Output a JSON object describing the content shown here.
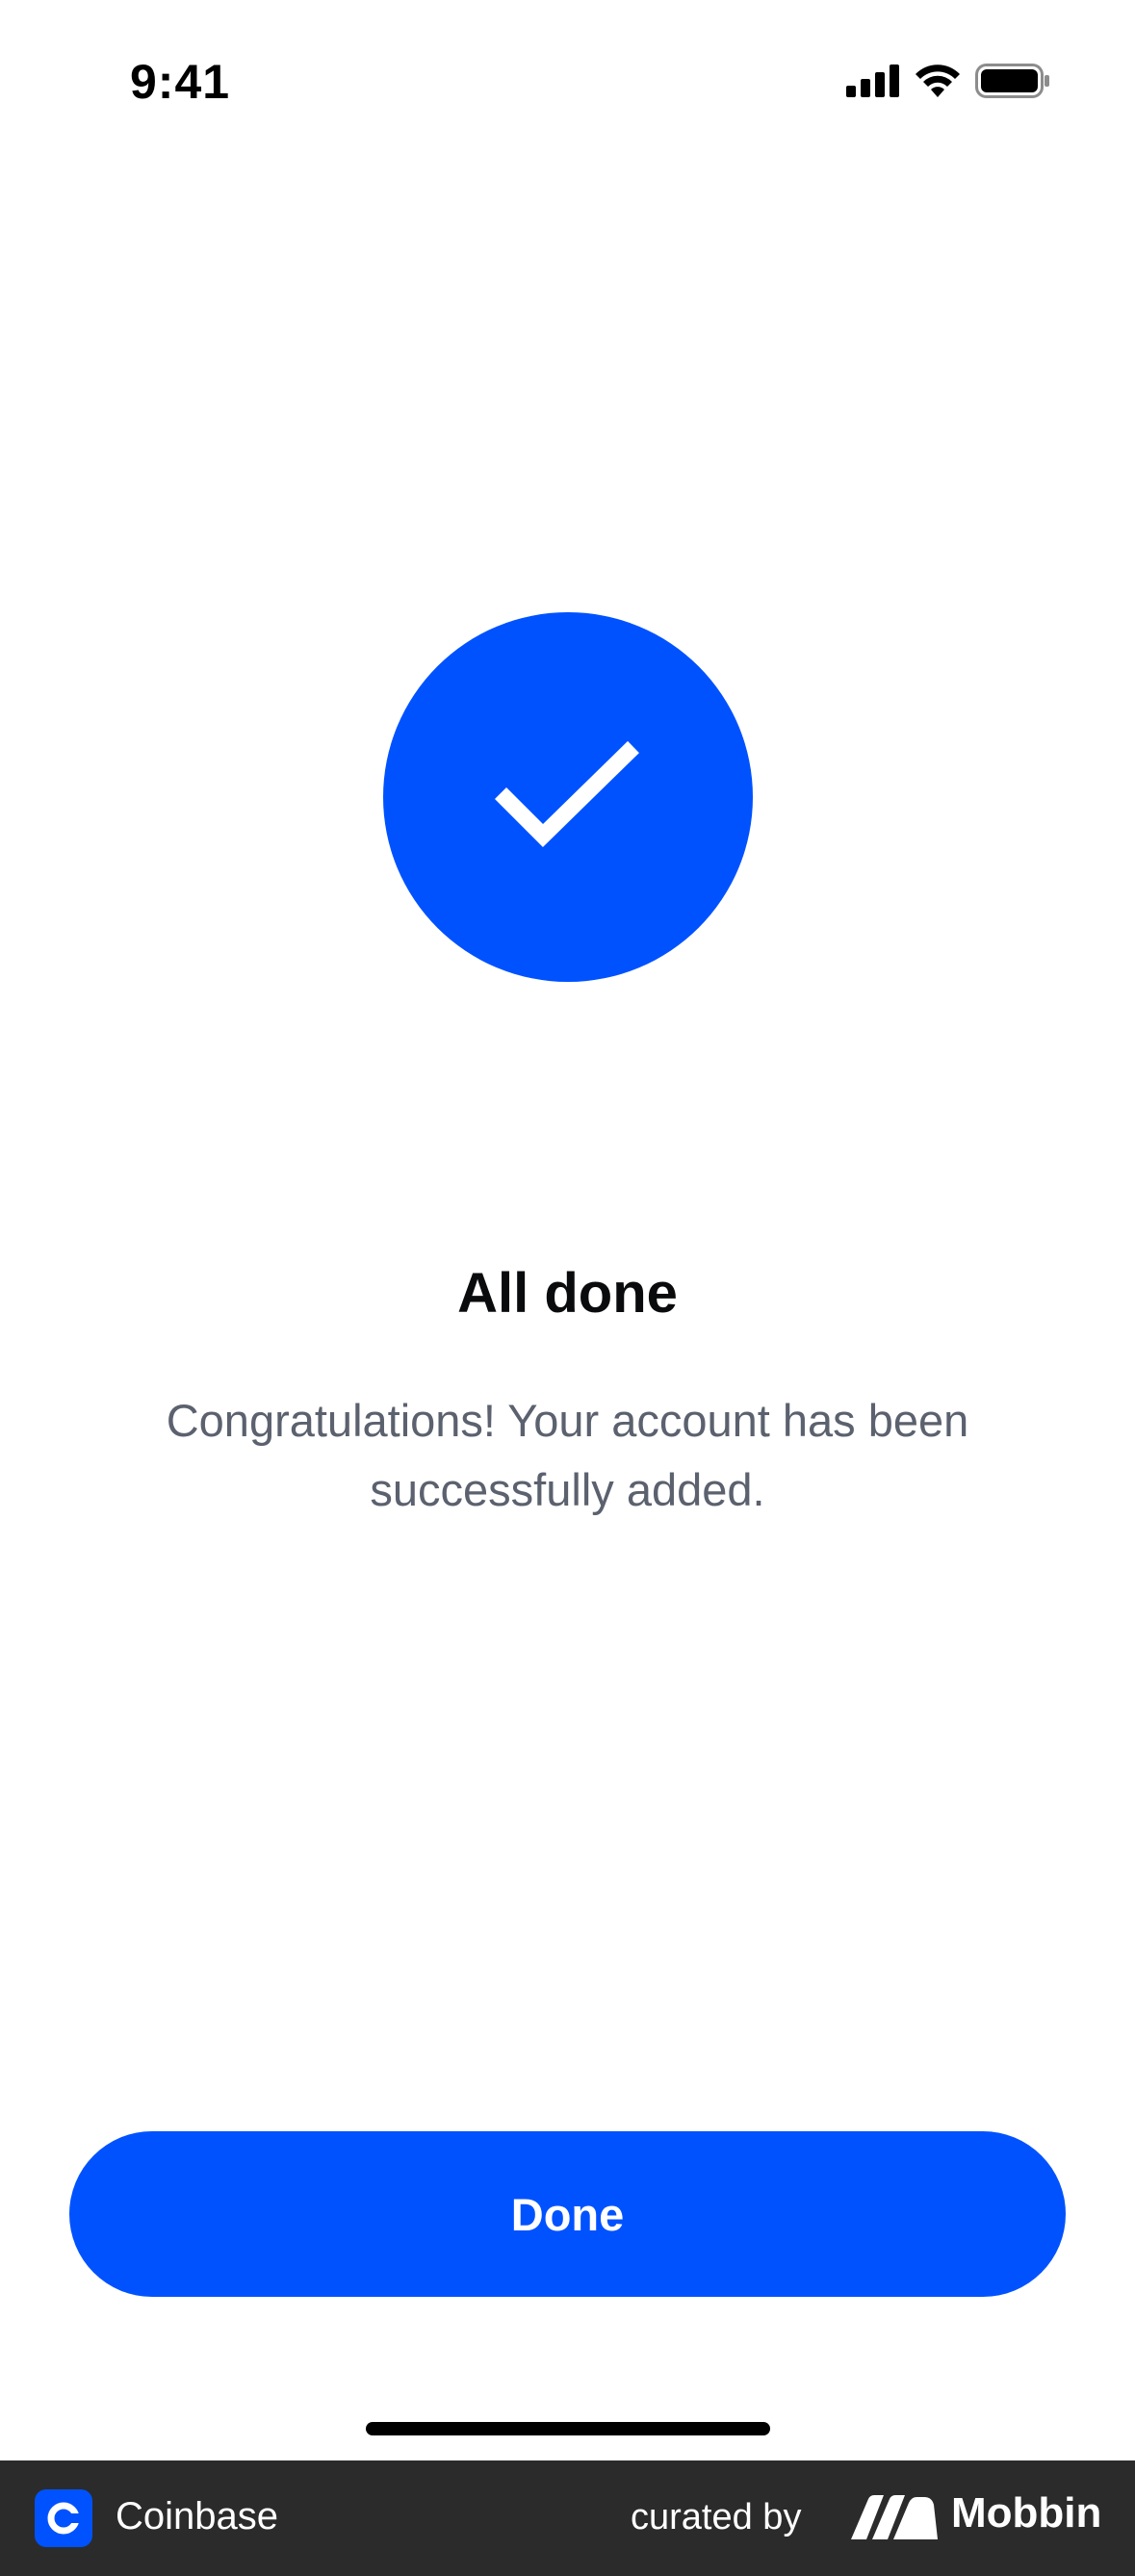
{
  "status_bar": {
    "time": "9:41",
    "icons": [
      "cellular-signal-icon",
      "wifi-icon",
      "battery-icon"
    ]
  },
  "success": {
    "icon": "checkmark-icon",
    "title": "All done",
    "message_line1": "Congratulations! Your account has been",
    "message_line2": "successfully added."
  },
  "actions": {
    "done_label": "Done"
  },
  "footer": {
    "app_name": "Coinbase",
    "curated_by": "curated by",
    "brand": "Mobbin"
  },
  "colors": {
    "primary": "#0052ff",
    "text_primary": "#0a0b0d",
    "text_secondary": "#5b616e",
    "footer_bg": "#2b2b2b"
  }
}
